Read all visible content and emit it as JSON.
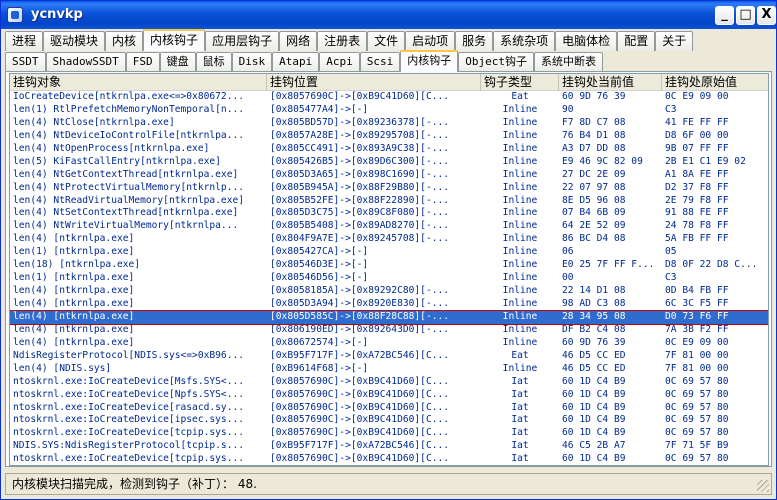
{
  "window": {
    "title": "ycnvkp",
    "minimize": "_",
    "maximize": "□",
    "close": "X"
  },
  "tabs_top": [
    {
      "label": "进程",
      "active": false
    },
    {
      "label": "驱动模块",
      "active": false
    },
    {
      "label": "内核",
      "active": false
    },
    {
      "label": "内核钩子",
      "active": true
    },
    {
      "label": "应用层钩子",
      "active": false
    },
    {
      "label": "网络",
      "active": false
    },
    {
      "label": "注册表",
      "active": false
    },
    {
      "label": "文件",
      "active": false
    },
    {
      "label": "启动项",
      "active": false
    },
    {
      "label": "服务",
      "active": false
    },
    {
      "label": "系统杂项",
      "active": false
    },
    {
      "label": "电脑体检",
      "active": false
    },
    {
      "label": "配置",
      "active": false
    },
    {
      "label": "关于",
      "active": false
    }
  ],
  "tabs_sub": [
    {
      "label": "SSDT",
      "active": false
    },
    {
      "label": "ShadowSSDT",
      "active": false
    },
    {
      "label": "FSD",
      "active": false
    },
    {
      "label": "键盘",
      "active": false
    },
    {
      "label": "鼠标",
      "active": false
    },
    {
      "label": "Disk",
      "active": false
    },
    {
      "label": "Atapi",
      "active": false
    },
    {
      "label": "Acpi",
      "active": false
    },
    {
      "label": "Scsi",
      "active": false
    },
    {
      "label": "内核钩子",
      "active": true
    },
    {
      "label": "Object钩子",
      "active": false
    },
    {
      "label": "系统中断表",
      "active": false
    }
  ],
  "columns": [
    "挂钩对象",
    "挂钩位置",
    "钩子类型",
    "挂钩处当前值",
    "挂钩处原始值"
  ],
  "rows": [
    [
      "IoCreateDevice[ntkrnlpa.exe<=>0x80672...",
      "[0x8057690C]->[0xB9C41D60][C...",
      "Eat",
      "60 9D 76 39",
      "0C E9 09 00"
    ],
    [
      "len(1) RtlPrefetchMemoryNonTemporal[n...",
      "[0x805477A4]->[-]",
      "Inline",
      "90",
      "C3"
    ],
    [
      "len(4) NtClose[ntkrnlpa.exe]",
      "[0x805BD57D]->[0x89236378][-...",
      "Inline",
      "F7 8D C7 08",
      "41 FE FF FF"
    ],
    [
      "len(4) NtDeviceIoControlFile[ntkrnlpa...",
      "[0x8057A28E]->[0x89295708][-...",
      "Inline",
      "76 B4 D1 08",
      "D8 6F 00 00"
    ],
    [
      "len(4) NtOpenProcess[ntkrnlpa.exe]",
      "[0x805CC491]->[0x893A9C38][-...",
      "Inline",
      "A3 D7 DD 08",
      "9B 07 FF FF"
    ],
    [
      "len(5) KiFastCallEntry[ntkrnlpa.exe]",
      "[0x805426B5]->[0x89D6C300][-...",
      "Inline",
      "E9 46 9C 82 09",
      "2B E1 C1 E9 02"
    ],
    [
      "len(4) NtGetContextThread[ntkrnlpa.exe]",
      "[0x805D3A65]->[0x898C1690][-...",
      "Inline",
      "27 DC 2E 09",
      "A1 8A FE FF"
    ],
    [
      "len(4) NtProtectVirtualMemory[ntkrnlp...",
      "[0x805B945A]->[0x88F29B80][-...",
      "Inline",
      "22 07 97 08",
      "D2 37 F8 FF"
    ],
    [
      "len(4) NtReadVirtualMemory[ntkrnlpa.exe]",
      "[0x805B52FE]->[0x88F22890][-...",
      "Inline",
      "8E D5 96 08",
      "2E 79 F8 FF"
    ],
    [
      "len(4) NtSetContextThread[ntkrnlpa.exe]",
      "[0x805D3C75]->[0x89C8F080][-...",
      "Inline",
      "07 B4 6B 09",
      "91 88 FE FF"
    ],
    [
      "len(4) NtWriteVirtualMemory[ntkrnlpa...",
      "[0x805B5408]->[0x89AD8270][-...",
      "Inline",
      "64 2E 52 09",
      "24 78 F8 FF"
    ],
    [
      "len(4) [ntkrnlpa.exe]",
      "[0x804F9A7E]->[0x89245708][-...",
      "Inline",
      "86 BC D4 08",
      "5A FB FF FF"
    ],
    [
      "len(1) [ntkrnlpa.exe]",
      "[0x805427CA]->[-]",
      "Inline",
      "06",
      "05"
    ],
    [
      "len(18) [ntkrnlpa.exe]",
      "[0x80546D3E]->[-]",
      "Inline",
      "E0 25 7F FF F...",
      "D8 0F 22 D8 C..."
    ],
    [
      "len(1) [ntkrnlpa.exe]",
      "[0x80546D56]->[-]",
      "Inline",
      "00",
      "C3"
    ],
    [
      "len(4) [ntkrnlpa.exe]",
      "[0x8058185A]->[0x89292C80][-...",
      "Inline",
      "22 14 D1 08",
      "0D B4 FB FF"
    ],
    [
      "len(4) [ntkrnlpa.exe]",
      "[0x805D3A94]->[0x8920E830][-...",
      "Inline",
      "98 AD C3 08",
      "6C 3C F5 FF"
    ],
    [
      "len(4) [ntkrnlpa.exe]",
      "[0x805D585C]->[0x88F28C88][-...",
      "Inline",
      "28 34 95 08",
      "D0 73 F6 FF"
    ],
    [
      "len(4) [ntkrnlpa.exe]",
      "[0x806190ED]->[0x892643D0][-...",
      "Inline",
      "DF B2 C4 08",
      "7A 3B F2 FF"
    ],
    [
      "len(4) [ntkrnlpa.exe]",
      "[0x80672574]->[-]",
      "Inline",
      "60 9D 76 39",
      "0C E9 09 00"
    ],
    [
      "NdisRegisterProtocol[NDIS.sys<=>0xB96...",
      "[0xB95F717F]->[0xA72BC546][C...",
      "Eat",
      "46 D5 CC ED",
      "7F 81 00 00"
    ],
    [
      "len(4) [NDIS.sys]",
      "[0xB9614F68]->[-]",
      "Inline",
      "46 D5 CC ED",
      "7F 81 00 00"
    ],
    [
      "ntoskrnl.exe:IoCreateDevice[Msfs.SYS<...",
      "[0x8057690C]->[0xB9C41D60][C...",
      "Iat",
      "60 1D C4 B9",
      "0C 69 57 80"
    ],
    [
      "ntoskrnl.exe:IoCreateDevice[Npfs.SYS<...",
      "[0x8057690C]->[0xB9C41D60][C...",
      "Iat",
      "60 1D C4 B9",
      "0C 69 57 80"
    ],
    [
      "ntoskrnl.exe:IoCreateDevice[rasacd.sy...",
      "[0x8057690C]->[0xB9C41D60][C...",
      "Iat",
      "60 1D C4 B9",
      "0C 69 57 80"
    ],
    [
      "ntoskrnl.exe:IoCreateDevice[ipsec.sys...",
      "[0x8057690C]->[0xB9C41D60][C...",
      "Iat",
      "60 1D C4 B9",
      "0C 69 57 80"
    ],
    [
      "ntoskrnl.exe:IoCreateDevice[tcpip.sys...",
      "[0x8057690C]->[0xB9C41D60][C...",
      "Iat",
      "60 1D C4 B9",
      "0C 69 57 80"
    ],
    [
      "NDIS.SYS:NdisRegisterProtocol[tcpip.s...",
      "[0xB95F717F]->[0xA72BC546][C...",
      "Iat",
      "46 C5 2B A7",
      "7F 71 5F B9"
    ],
    [
      "ntoskrnl.exe:IoCreateDevice[tcpip.sys...",
      "[0x8057690C]->[0xB9C41D60][C...",
      "Iat",
      "60 1D C4 B9",
      "0C 69 57 80"
    ]
  ],
  "selected_row": 17,
  "status": "内核模块扫描完成，检测到钩子（补丁）：  48.",
  "colors": {
    "accent": "#0a52d8",
    "selection": "#2f6cd0",
    "text": "#002a8f"
  }
}
